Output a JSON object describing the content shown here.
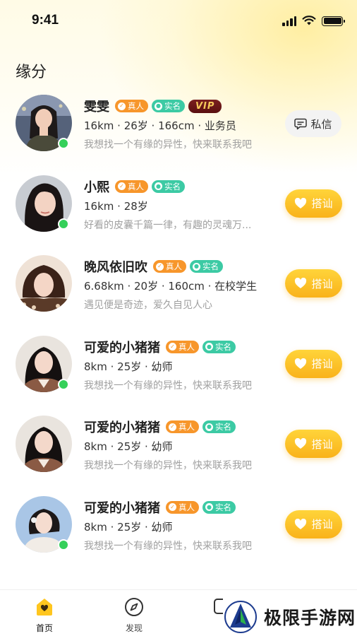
{
  "status_bar": {
    "time": "9:41"
  },
  "header": {
    "title": "缘分"
  },
  "users": [
    {
      "name": "雯雯",
      "tags": {
        "real": "真人",
        "verified": "实名",
        "vip": "VIP"
      },
      "info": "16km · 26岁 · 166cm · 业务员",
      "bio": "我想找一个有缘的异性，快来联系我吧",
      "online": true,
      "action": {
        "type": "dm",
        "label": "私信",
        "icon": "message-icon"
      }
    },
    {
      "name": "小熙",
      "tags": {
        "real": "真人",
        "verified": "实名"
      },
      "info": "16km · 28岁",
      "bio": "好看的皮囊千篇一律，有趣的灵魂万...",
      "online": true,
      "action": {
        "type": "chat",
        "label": "搭讪",
        "icon": "heart-icon"
      }
    },
    {
      "name": "晚风依旧吹",
      "tags": {
        "real": "真人",
        "verified": "实名"
      },
      "info": "6.68km · 20岁 · 160cm · 在校学生",
      "bio": "遇见便是奇迹，爱久自见人心",
      "online": false,
      "action": {
        "type": "chat",
        "label": "搭讪",
        "icon": "heart-icon"
      }
    },
    {
      "name": "可爱的小猪猪",
      "tags": {
        "real": "真人",
        "verified": "实名"
      },
      "info": "8km · 25岁 · 幼师",
      "bio": "我想找一个有缘的异性，快来联系我吧",
      "online": true,
      "action": {
        "type": "chat",
        "label": "搭讪",
        "icon": "heart-icon"
      }
    },
    {
      "name": "可爱的小猪猪",
      "tags": {
        "real": "真人",
        "verified": "实名"
      },
      "info": "8km · 25岁 · 幼师",
      "bio": "我想找一个有缘的异性，快来联系我吧",
      "online": false,
      "action": {
        "type": "chat",
        "label": "搭讪",
        "icon": "heart-icon"
      }
    },
    {
      "name": "可爱的小猪猪",
      "tags": {
        "real": "真人",
        "verified": "实名"
      },
      "info": "8km · 25岁 · 幼师",
      "bio": "我想找一个有缘的异性，快来联系我吧",
      "online": true,
      "action": {
        "type": "chat",
        "label": "搭讪",
        "icon": "heart-icon"
      }
    }
  ],
  "tabbar": {
    "items": [
      {
        "label": "首页",
        "icon": "home-icon",
        "active": true
      },
      {
        "label": "发现",
        "icon": "compass-icon",
        "active": false
      }
    ]
  },
  "watermark": {
    "text": "极限手游网"
  },
  "colors": {
    "accent_yellow": "#f9b21a",
    "online_green": "#35d05a",
    "tag_real_orange": "#f7962b",
    "tag_verified_teal": "#3ccaa4",
    "vip_dark_red": "#6a1515",
    "vip_gold": "#f5c85a"
  }
}
